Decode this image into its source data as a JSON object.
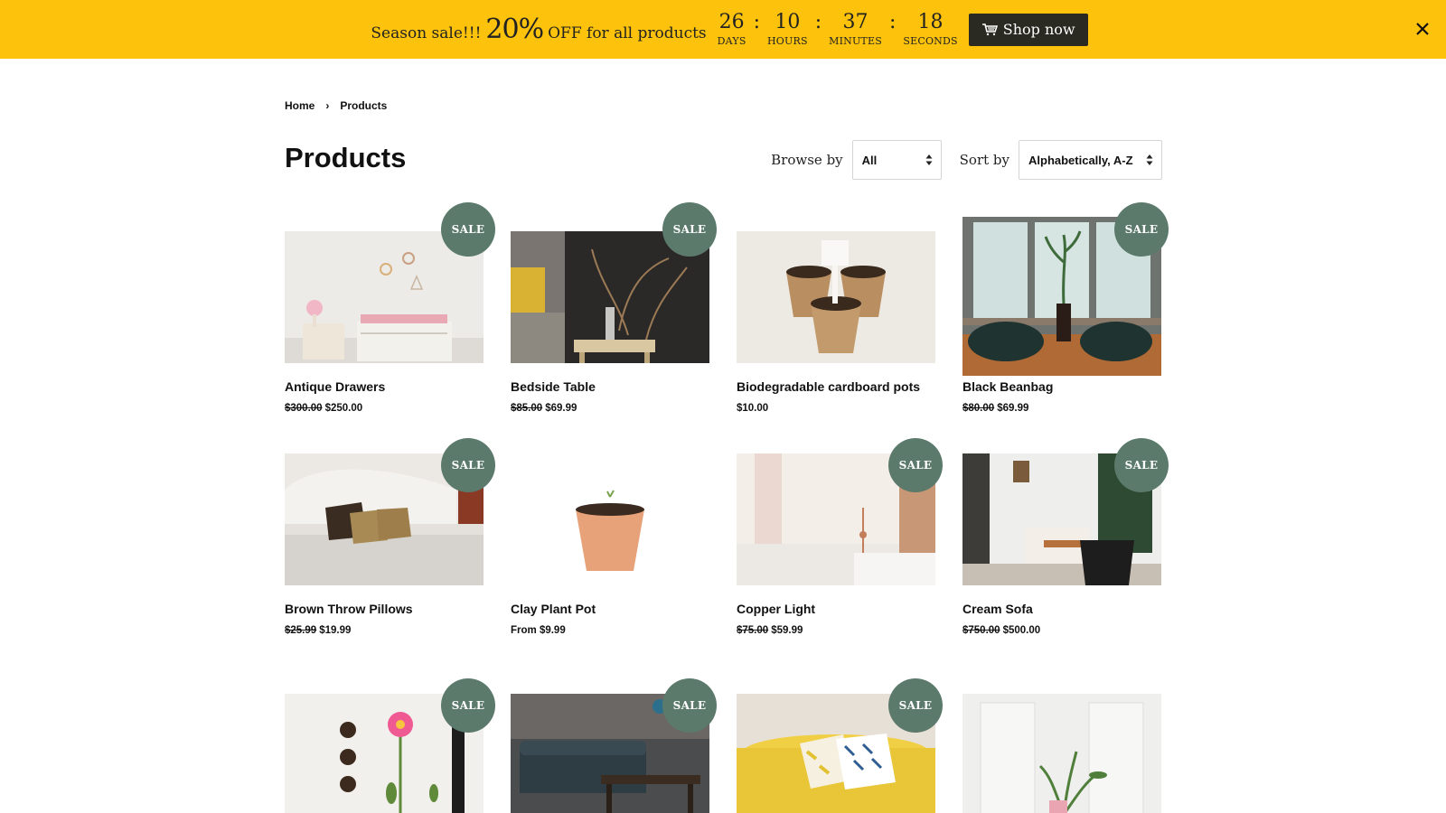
{
  "promo": {
    "lead": "Season sale!!!",
    "percent": "20%",
    "tail": "OFF for all products",
    "countdown": [
      {
        "value": "26",
        "label": "DAYS"
      },
      {
        "value": "10",
        "label": "HOURS"
      },
      {
        "value": "37",
        "label": "MINUTES"
      },
      {
        "value": "18",
        "label": "SECONDS"
      }
    ],
    "separator": ":",
    "button_label": "Shop now",
    "close_icon": "close-icon",
    "bar_color": "#fdc20b"
  },
  "breadcrumb": {
    "home": "Home",
    "separator": "›",
    "current": "Products"
  },
  "page": {
    "title": "Products"
  },
  "filters": {
    "browse_label": "Browse by",
    "browse_value": "All",
    "sort_label": "Sort by",
    "sort_value": "Alphabetically, A-Z"
  },
  "sale_badge_text": "SALE",
  "sale_badge_color": "#5b7a6c",
  "products": [
    {
      "title": "Antique Drawers",
      "was": "$300.00",
      "price": "$250.00",
      "sale": true
    },
    {
      "title": "Bedside Table",
      "was": "$85.00",
      "price": "$69.99",
      "sale": true
    },
    {
      "title": "Biodegradable cardboard pots",
      "was": "",
      "price": "$10.00",
      "sale": false
    },
    {
      "title": "Black Beanbag",
      "was": "$80.00",
      "price": "$69.99",
      "sale": true
    },
    {
      "title": "Brown Throw Pillows",
      "was": "$25.99",
      "price": "$19.99",
      "sale": true
    },
    {
      "title": "Clay Plant Pot",
      "was": "",
      "price": "From $9.99",
      "sale": false
    },
    {
      "title": "Copper Light",
      "was": "$75.00",
      "price": "$59.99",
      "sale": true
    },
    {
      "title": "Cream Sofa",
      "was": "$750.00",
      "price": "$500.00",
      "sale": true
    },
    {
      "title": "",
      "was": "",
      "price": "",
      "sale": true
    },
    {
      "title": "",
      "was": "",
      "price": "",
      "sale": true
    },
    {
      "title": "",
      "was": "",
      "price": "",
      "sale": true
    },
    {
      "title": "",
      "was": "",
      "price": "",
      "sale": false
    }
  ]
}
